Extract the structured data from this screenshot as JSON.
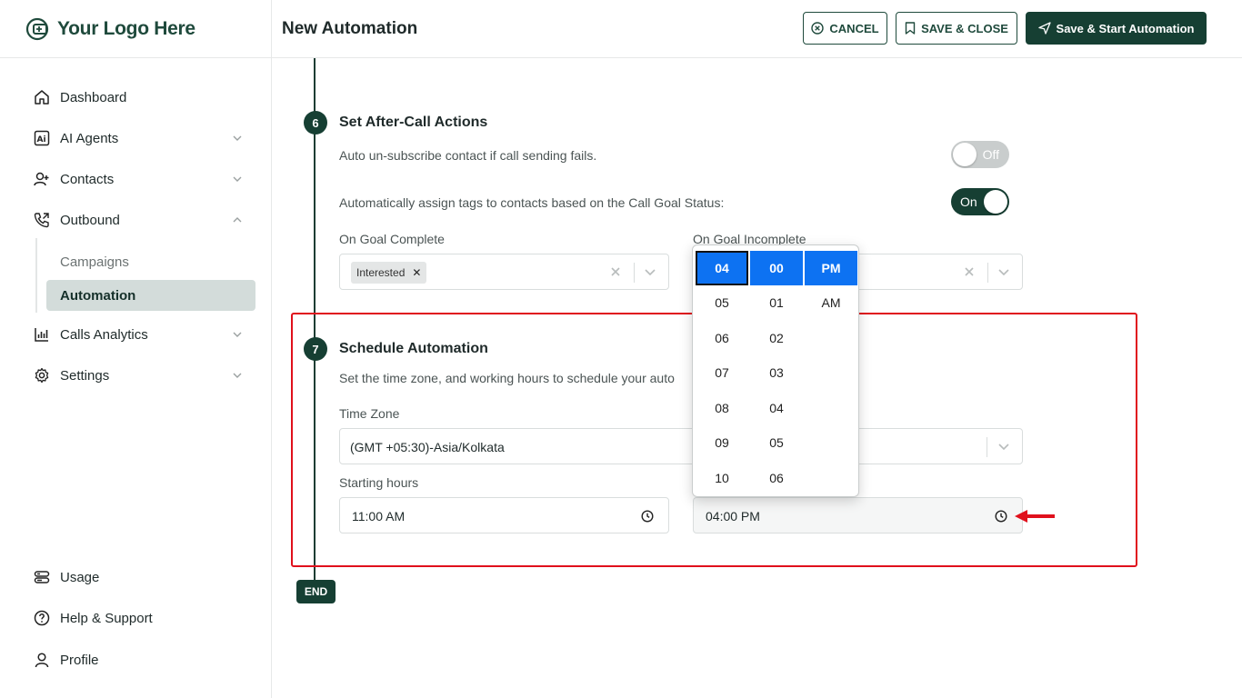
{
  "brand": {
    "logo_text": "Your Logo Here",
    "accent": "#163f33"
  },
  "sidebar": {
    "items": [
      {
        "label": "Dashboard",
        "icon": "home-icon"
      },
      {
        "label": "AI Agents",
        "icon": "ai-agents-icon"
      },
      {
        "label": "Contacts",
        "icon": "add-user-icon"
      },
      {
        "label": "Outbound",
        "icon": "phone-outbound-icon"
      },
      {
        "label": "Calls Analytics",
        "icon": "bar-chart-icon"
      },
      {
        "label": "Settings",
        "icon": "gear-icon"
      }
    ],
    "outbound_sub": [
      {
        "label": "Campaigns",
        "active": false
      },
      {
        "label": "Automation",
        "active": true
      }
    ],
    "bottom": [
      {
        "label": "Usage",
        "icon": "usage-icon"
      },
      {
        "label": "Help & Support",
        "icon": "help-icon"
      },
      {
        "label": "Profile",
        "icon": "user-icon"
      }
    ]
  },
  "header": {
    "title": "New Automation",
    "cancel_label": "CANCEL",
    "save_close_label": "SAVE & CLOSE",
    "save_start_label": "Save & Start Automation"
  },
  "step6": {
    "number": "6",
    "title": "Set After-Call Actions",
    "unsubscribe_text": "Auto un-subscribe contact if call sending fails.",
    "unsubscribe_toggle": "Off",
    "assign_tags_text": "Automatically assign tags to contacts based on the Call Goal Status:",
    "assign_tags_toggle": "On",
    "goal_complete_label": "On Goal Complete",
    "goal_complete_tag": "Interested",
    "goal_incomplete_label": "On Goal Incomplete"
  },
  "step7": {
    "number": "7",
    "title": "Schedule Automation",
    "description": "Set the time zone, and working hours to schedule your auto",
    "timezone_label": "Time Zone",
    "timezone_value": "(GMT +05:30)-Asia/Kolkata",
    "starting_hours_label": "Starting hours",
    "starting_hours_value": "11:00  AM",
    "ending_hours_value": "04:00  PM"
  },
  "end_label": "END",
  "time_picker": {
    "hours": [
      "04",
      "05",
      "06",
      "07",
      "08",
      "09",
      "10"
    ],
    "minutes": [
      "00",
      "01",
      "02",
      "03",
      "04",
      "05",
      "06"
    ],
    "periods": [
      "PM",
      "AM"
    ],
    "selected_hour": "04",
    "selected_minute": "00",
    "selected_period": "PM"
  }
}
